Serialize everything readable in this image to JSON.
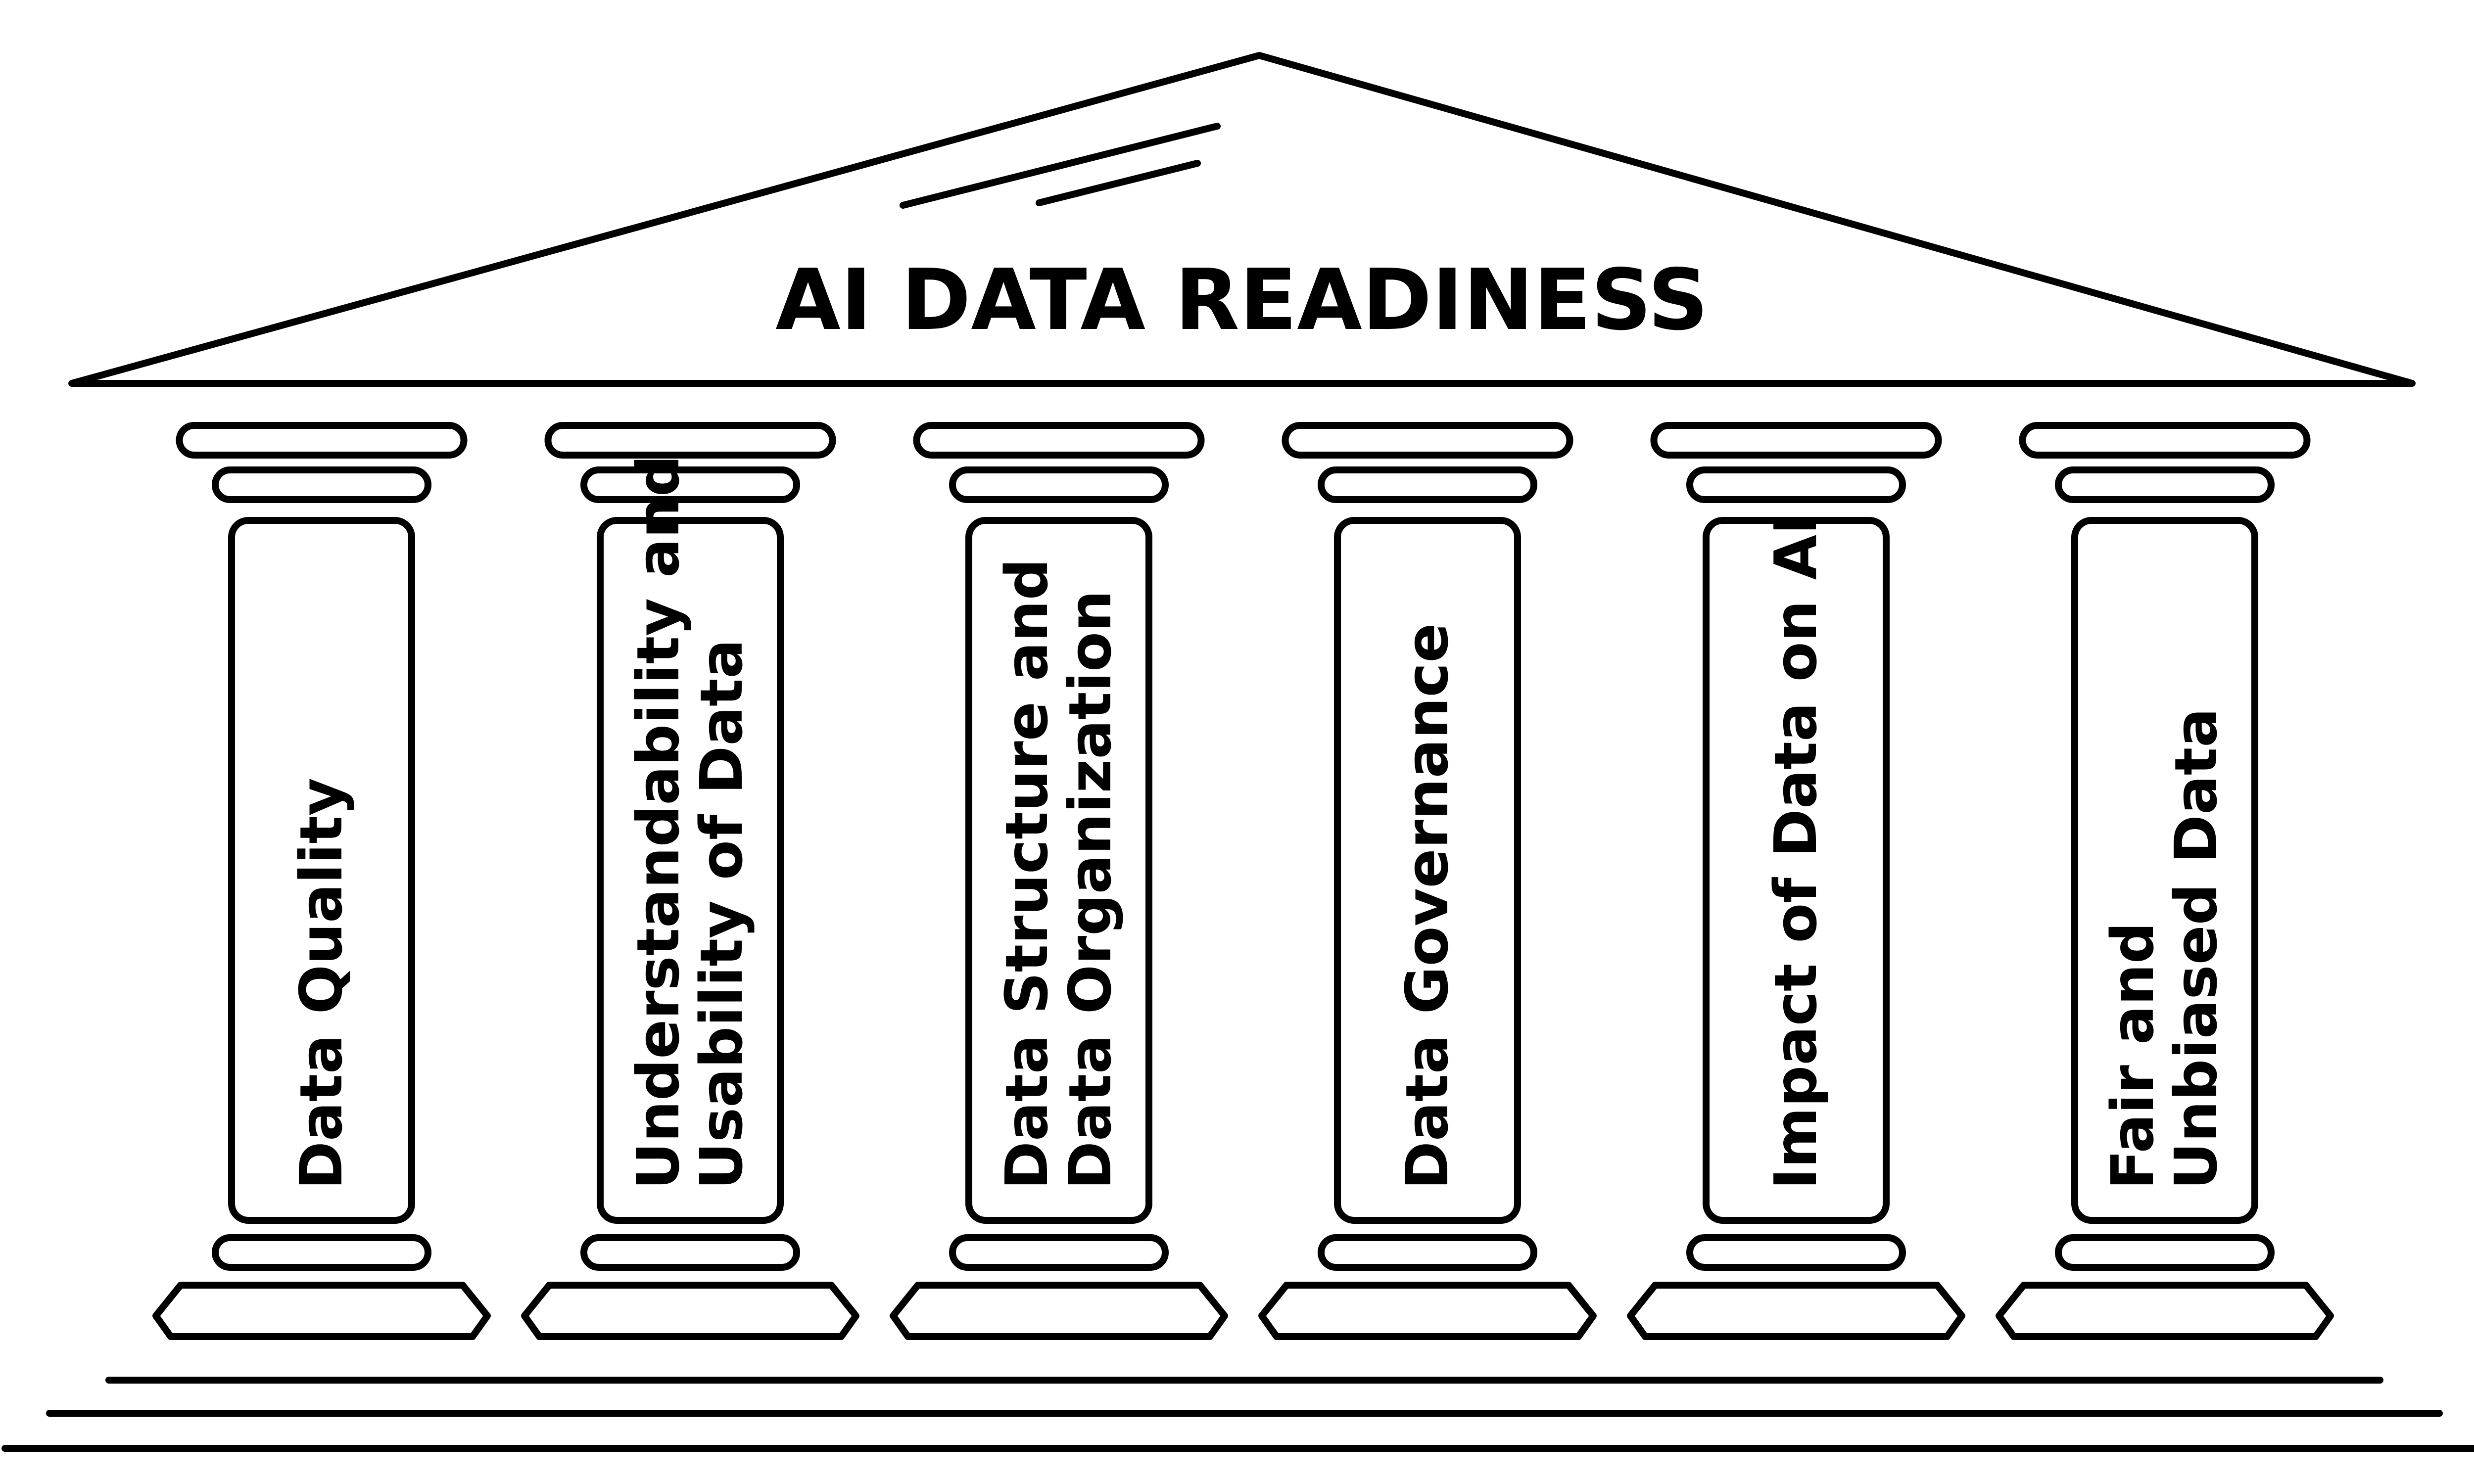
{
  "title": "AI DATA READINESS",
  "pillars": [
    {
      "lines": [
        "Data Quality"
      ]
    },
    {
      "lines": [
        "Understandability and",
        "Usability of Data"
      ]
    },
    {
      "lines": [
        "Data Structure and",
        "Data Organization"
      ]
    },
    {
      "lines": [
        "Data Governance"
      ]
    },
    {
      "lines": [
        "Impact of Data on AI"
      ]
    },
    {
      "lines": [
        "Fair and",
        "Unbiased Data"
      ]
    }
  ]
}
